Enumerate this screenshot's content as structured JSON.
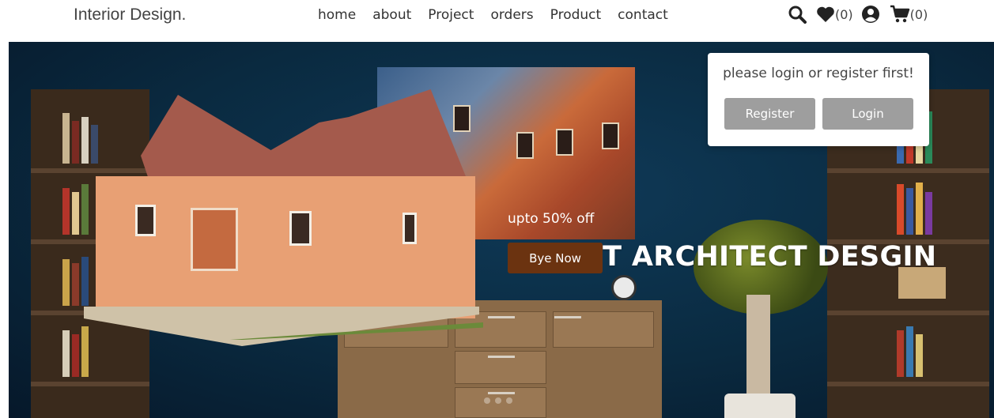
{
  "header": {
    "logo": "Interior Design.",
    "nav": [
      "home",
      "about",
      "Project",
      "orders",
      "Product",
      "contact"
    ],
    "wishlist_count": "(0)",
    "cart_count": "(0)",
    "icons": [
      "search-icon",
      "heart-icon",
      "user-icon",
      "cart-icon"
    ]
  },
  "hero": {
    "promo": "upto 50% off",
    "headline": "LATEST ARCHITECT DESGIN",
    "cta": "Bye Now"
  },
  "login_popup": {
    "message": "please login or register first!",
    "register_label": "Register",
    "login_label": "Login"
  },
  "colors": {
    "cta": "#6b3310",
    "popup_button": "#9e9e9e",
    "hero_bg": "#0f3a58"
  }
}
